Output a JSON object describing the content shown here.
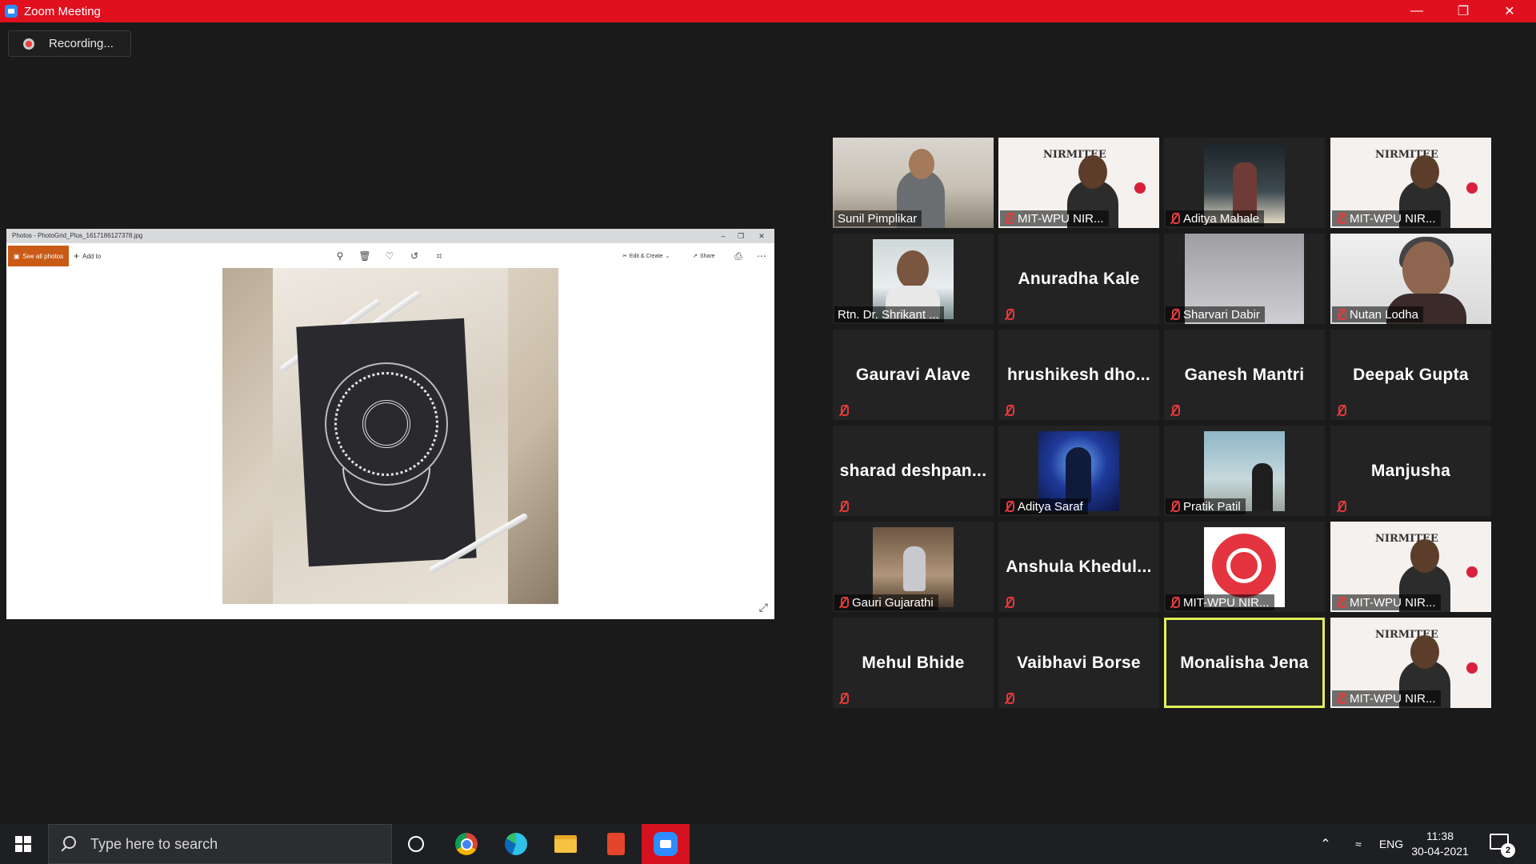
{
  "window": {
    "title": "Zoom Meeting",
    "title_bar_color": "#e0101f"
  },
  "recording": {
    "label": "Recording..."
  },
  "shared_screen": {
    "title": "Photos - PhotoGrid_Plus_1617186127378.jpg",
    "see_all_label": "See all photos",
    "add_to_label": "Add to",
    "edit_create_label": "Edit & Create",
    "share_label": "Share",
    "accent_color": "#c95b16"
  },
  "participants": [
    {
      "name": "Sunil Pimplikar",
      "video": "room",
      "muted": false
    },
    {
      "name": "MIT-WPU NIR...",
      "video": "banner",
      "muted": true
    },
    {
      "name": "Aditya Mahale",
      "video": "night",
      "muted": true
    },
    {
      "name": "MIT-WPU NIR...",
      "video": "banner",
      "muted": true
    },
    {
      "name": "Rtn. Dr. Shrikant ...",
      "video": "photo",
      "muted": false
    },
    {
      "name": "Anuradha Kale",
      "video": "none",
      "muted": true
    },
    {
      "name": "Sharvari Dabir",
      "video": "wall",
      "muted": true
    },
    {
      "name": "Nutan Lodha",
      "video": "lady",
      "muted": true
    },
    {
      "name": "Gauravi Alave",
      "video": "none",
      "muted": true
    },
    {
      "name": "hrushikesh  dho...",
      "video": "none",
      "muted": true
    },
    {
      "name": "Ganesh Mantri",
      "video": "none",
      "muted": true
    },
    {
      "name": "Deepak Gupta",
      "video": "none",
      "muted": true
    },
    {
      "name": "sharad  deshpan...",
      "video": "none",
      "muted": true
    },
    {
      "name": "Aditya Saraf",
      "video": "game",
      "muted": true
    },
    {
      "name": "Pratik Patil",
      "video": "sky",
      "muted": true
    },
    {
      "name": "Manjusha",
      "video": "none",
      "muted": true
    },
    {
      "name": "Gauri Gujarathi",
      "video": "porch",
      "muted": true
    },
    {
      "name": "Anshula  Khedul...",
      "video": "none",
      "muted": true
    },
    {
      "name": "MIT-WPU NIR...",
      "video": "award",
      "muted": true
    },
    {
      "name": "MIT-WPU NIR...",
      "video": "banner",
      "muted": true
    },
    {
      "name": "Mehul Bhide",
      "video": "none",
      "muted": true
    },
    {
      "name": "Vaibhavi Borse",
      "video": "none",
      "muted": true
    },
    {
      "name": "Monalisha Jena",
      "video": "none",
      "muted": false,
      "active_speaker": true
    },
    {
      "name": "MIT-WPU NIR...",
      "video": "banner",
      "muted": true
    }
  ],
  "banner_text": "NIRMITEE",
  "taskbar": {
    "search_placeholder": "Type here to search",
    "language": "ENG",
    "time": "11:38",
    "date": "30-04-2021",
    "notification_count": "2"
  }
}
